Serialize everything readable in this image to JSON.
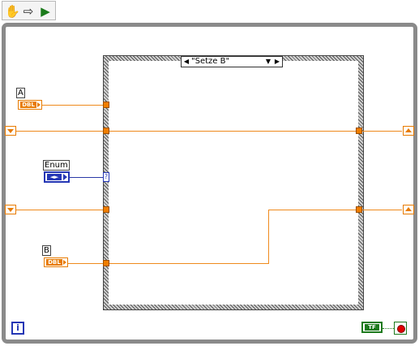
{
  "toolbar": {
    "icons": [
      "hand-tool-icon",
      "arrow-tool-icon",
      "run-arrow-icon"
    ]
  },
  "case_structure": {
    "selector_label": "\"Setze B\"",
    "selector_terminal": "?"
  },
  "controls": {
    "a": {
      "label": "A",
      "type": "DBL"
    },
    "enum": {
      "label": "Enum",
      "glyph": "◄►"
    },
    "b": {
      "label": "B",
      "type": "DBL"
    }
  },
  "loop": {
    "iteration_label": "i",
    "bool_constant": "TF"
  },
  "colors": {
    "dbl_wire": "#ef8a1d",
    "enum_wire": "#2b3aa8",
    "boolean": "#1e7a1e",
    "loop_border": "#8a8a8a"
  }
}
